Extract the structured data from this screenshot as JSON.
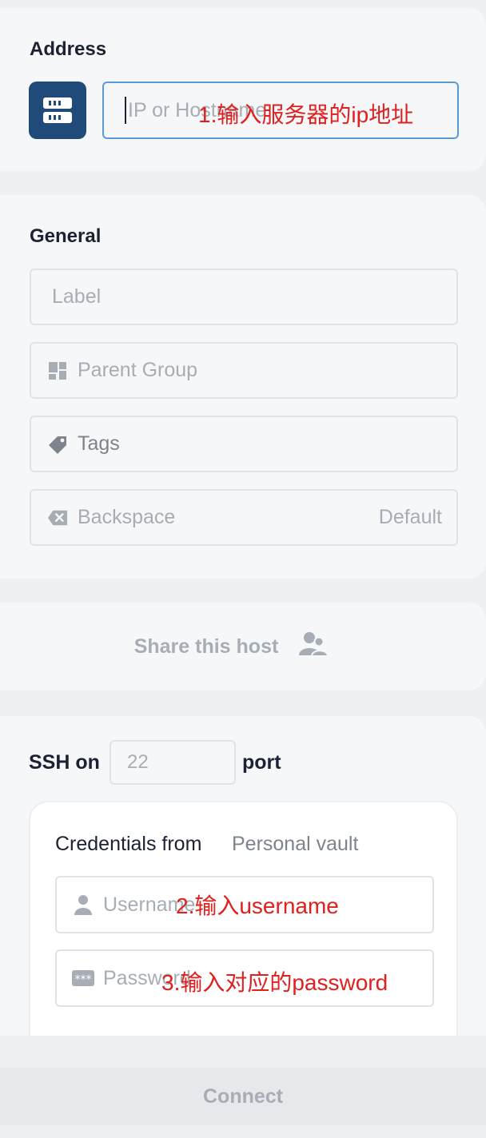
{
  "address": {
    "title": "Address",
    "placeholder": "IP or Hostname",
    "annotation": "1.输入服务器的ip地址"
  },
  "general": {
    "title": "General",
    "label_placeholder": "Label",
    "parent_group_placeholder": "Parent Group",
    "tags_placeholder": "Tags",
    "backspace_label": "Backspace",
    "backspace_value": "Default"
  },
  "share": {
    "label": "Share this host"
  },
  "ssh": {
    "prefix": "SSH on",
    "port_placeholder": "22",
    "suffix": "port",
    "credentials_label": "Credentials from",
    "vault": "Personal vault",
    "username_placeholder": "Username",
    "username_annotation": "2.输入username",
    "password_placeholder": "Password",
    "password_annotation": "3.输入对应的password"
  },
  "footer": {
    "connect_label": "Connect"
  },
  "colors": {
    "accent": "#1f4a7a",
    "focus_border": "#5b9bd5",
    "annotation": "#e0201e"
  }
}
